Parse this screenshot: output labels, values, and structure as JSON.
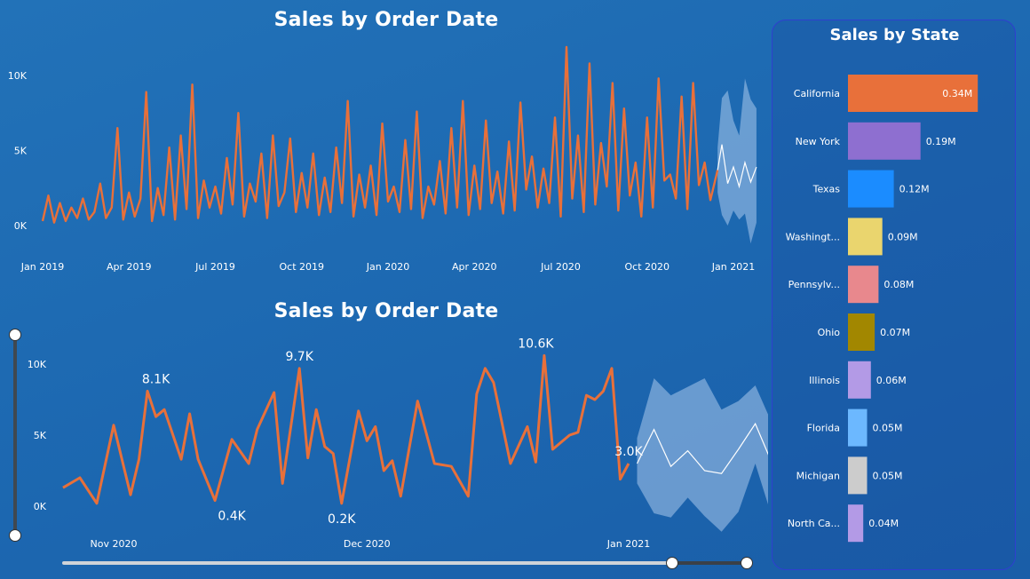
{
  "charts": {
    "top_title": "Sales by Order Date",
    "bottom_title": "Sales by Order Date",
    "state_title": "Sales by State"
  },
  "colors": {
    "line": "#e8703a",
    "forecast_line": "#ffffff",
    "forecast_band": "#a9c8ec",
    "background": "#1f6bb3"
  },
  "chart_data": [
    {
      "type": "line",
      "title": "Sales by Order Date",
      "x_tick_labels": [
        "Jan 2019",
        "Apr 2019",
        "Jul 2019",
        "Oct 2019",
        "Jan 2020",
        "Apr 2020",
        "Jul 2020",
        "Oct 2020",
        "Jan 2021"
      ],
      "y_tick_labels": [
        "0K",
        "5K",
        "10K"
      ],
      "ylim": [
        0,
        10000
      ],
      "x_range_months": [
        0,
        24
      ],
      "forecast_start_month": 23.45,
      "series_x_months": [
        0.0,
        0.2,
        0.4,
        0.6,
        0.8,
        1.0,
        1.2,
        1.4,
        1.6,
        1.8,
        2.0,
        2.2,
        2.4,
        2.6,
        2.8,
        3.0,
        3.2,
        3.4,
        3.6,
        3.8,
        4.0,
        4.2,
        4.4,
        4.6,
        4.8,
        5.0,
        5.2,
        5.4,
        5.6,
        5.8,
        6.0,
        6.2,
        6.4,
        6.6,
        6.8,
        7.0,
        7.2,
        7.4,
        7.6,
        7.8,
        8.0,
        8.2,
        8.4,
        8.6,
        8.8,
        9.0,
        9.2,
        9.4,
        9.6,
        9.8,
        10.0,
        10.2,
        10.4,
        10.6,
        10.8,
        11.0,
        11.2,
        11.4,
        11.6,
        11.8,
        12.0,
        12.2,
        12.4,
        12.6,
        12.8,
        13.0,
        13.2,
        13.4,
        13.6,
        13.8,
        14.0,
        14.2,
        14.4,
        14.6,
        14.8,
        15.0,
        15.2,
        15.4,
        15.6,
        15.8,
        16.0,
        16.2,
        16.4,
        16.6,
        16.8,
        17.0,
        17.2,
        17.4,
        17.6,
        17.8,
        18.0,
        18.2,
        18.4,
        18.6,
        18.8,
        19.0,
        19.2,
        19.4,
        19.6,
        19.8,
        20.0,
        20.2,
        20.4,
        20.6,
        20.8,
        21.0,
        21.2,
        21.4,
        21.6,
        21.8,
        22.0,
        22.2,
        22.4,
        22.6,
        22.8,
        23.0,
        23.2,
        23.45
      ],
      "series_values": [
        300,
        2000,
        200,
        1500,
        300,
        1200,
        500,
        1800,
        400,
        900,
        2800,
        500,
        1200,
        6500,
        400,
        2200,
        600,
        1800,
        8900,
        300,
        2500,
        700,
        5200,
        400,
        6000,
        1100,
        9400,
        500,
        3000,
        1200,
        2600,
        800,
        4500,
        1400,
        7500,
        600,
        2800,
        1600,
        4800,
        500,
        6000,
        1300,
        2200,
        5800,
        900,
        3500,
        1200,
        4800,
        700,
        3200,
        900,
        5200,
        1500,
        8300,
        600,
        3400,
        1200,
        4000,
        700,
        6800,
        1600,
        2600,
        900,
        5700,
        1100,
        7600,
        500,
        2600,
        1400,
        4300,
        800,
        6500,
        1200,
        8300,
        700,
        4000,
        1100,
        7000,
        1500,
        3600,
        800,
        5600,
        1000,
        8200,
        2400,
        4600,
        1200,
        3800,
        1500,
        7200,
        600,
        11900,
        1800,
        6000,
        900,
        10800,
        1400,
        5500,
        2600,
        9500,
        1000,
        7800,
        2000,
        4200,
        600,
        7200,
        1200,
        9800,
        3000,
        3400,
        1800,
        8600,
        1100,
        9500,
        2700,
        4200,
        1700,
        3700
      ],
      "forecast_x_months": [
        23.45,
        23.6,
        23.8,
        24.0,
        24.2,
        24.4,
        24.6,
        24.8
      ],
      "forecast_values": [
        3700,
        5400,
        2800,
        3900,
        2600,
        4200,
        2900,
        3900
      ],
      "forecast_upper": [
        5200,
        8500,
        9000,
        7000,
        6000,
        9800,
        8400,
        7800
      ],
      "forecast_lower": [
        2200,
        700,
        0,
        1000,
        400,
        800,
        -1200,
        200
      ]
    },
    {
      "type": "line",
      "title": "Sales by Order Date",
      "x_tick_labels": [
        "Nov 2020",
        "Dec 2020",
        "Jan 2021"
      ],
      "y_tick_labels": [
        "0K",
        "5K",
        "10K"
      ],
      "ylim": [
        0,
        10000
      ],
      "x_tick_days": [
        1,
        31,
        62
      ],
      "series_x_days": [
        -5,
        -3,
        -1,
        1,
        3,
        4,
        5,
        6,
        7,
        9,
        10,
        11,
        13,
        15,
        17,
        18,
        20,
        21,
        23,
        24,
        25,
        26,
        27,
        28,
        30,
        31,
        32,
        33,
        34,
        35,
        37,
        39,
        41,
        43,
        44,
        45,
        46,
        48,
        50,
        51,
        52,
        53,
        55,
        56,
        57,
        58,
        59,
        60,
        61,
        62
      ],
      "series_values": [
        1300,
        2000,
        200,
        5700,
        800,
        3300,
        8100,
        6300,
        6800,
        3300,
        6500,
        3300,
        400,
        4700,
        3000,
        5400,
        8000,
        1600,
        9700,
        3400,
        6800,
        4200,
        3700,
        200,
        6700,
        4600,
        5600,
        2500,
        3200,
        700,
        7400,
        3000,
        2800,
        700,
        7900,
        9700,
        8700,
        3000,
        5600,
        3100,
        10600,
        4000,
        5000,
        5200,
        7800,
        7500,
        8100,
        9700,
        1900,
        3000
      ],
      "forecast_x_days": [
        63,
        65,
        67,
        69,
        71,
        73,
        75,
        77,
        79,
        81
      ],
      "forecast_values": [
        3000,
        5400,
        2800,
        3900,
        2500,
        2300,
        4000,
        5800,
        3000,
        3700
      ],
      "forecast_upper": [
        4800,
        9000,
        7800,
        8400,
        9000,
        6800,
        7400,
        8500,
        5800,
        7800
      ],
      "forecast_lower": [
        1600,
        -500,
        -800,
        600,
        -700,
        -1800,
        -400,
        3000,
        -800,
        -700
      ],
      "data_labels": [
        {
          "x_day": 6,
          "value": 8100,
          "text": "8.1K",
          "pos": "above"
        },
        {
          "x_day": 15,
          "value": 400,
          "text": "0.4K",
          "pos": "below"
        },
        {
          "x_day": 23,
          "value": 9700,
          "text": "9.7K",
          "pos": "above"
        },
        {
          "x_day": 28,
          "value": 200,
          "text": "0.2K",
          "pos": "below"
        },
        {
          "x_day": 51,
          "value": 10600,
          "text": "10.6K",
          "pos": "above"
        },
        {
          "x_day": 62,
          "value": 3000,
          "text": "3.0K",
          "pos": "above"
        }
      ]
    },
    {
      "type": "bar",
      "orientation": "horizontal",
      "title": "Sales by State",
      "categories": [
        "California",
        "New York",
        "Texas",
        "Washingt...",
        "Pennsylv...",
        "Ohio",
        "Illinois",
        "Florida",
        "Michigan",
        "North Ca..."
      ],
      "values": [
        0.34,
        0.19,
        0.12,
        0.09,
        0.08,
        0.07,
        0.06,
        0.05,
        0.05,
        0.04
      ],
      "value_labels": [
        "0.34M",
        "0.19M",
        "0.12M",
        "0.09M",
        "0.08M",
        "0.07M",
        "0.06M",
        "0.05M",
        "0.05M",
        "0.04M"
      ],
      "unit": "M",
      "colors": [
        "#e8703a",
        "#8e6fd0",
        "#1b8cff",
        "#ead56e",
        "#e8888d",
        "#a28700",
        "#b39ae6",
        "#6cb8ff",
        "#cccccc",
        "#b39ae6"
      ]
    }
  ]
}
